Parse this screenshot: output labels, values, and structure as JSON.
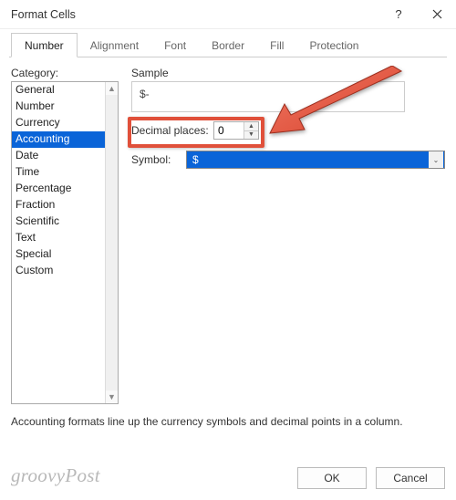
{
  "title": "Format Cells",
  "tabs": [
    "Number",
    "Alignment",
    "Font",
    "Border",
    "Fill",
    "Protection"
  ],
  "active_tab": 0,
  "category_label": "Category:",
  "categories": [
    "General",
    "Number",
    "Currency",
    "Accounting",
    "Date",
    "Time",
    "Percentage",
    "Fraction",
    "Scientific",
    "Text",
    "Special",
    "Custom"
  ],
  "selected_category": 3,
  "sample_label": "Sample",
  "sample_value": "$-",
  "decimal_label": "Decimal places:",
  "decimal_value": "0",
  "symbol_label": "Symbol:",
  "symbol_value": "$",
  "description": "Accounting formats line up the currency symbols and decimal points in a column.",
  "ok_label": "OK",
  "cancel_label": "Cancel",
  "watermark": "groovyPost"
}
